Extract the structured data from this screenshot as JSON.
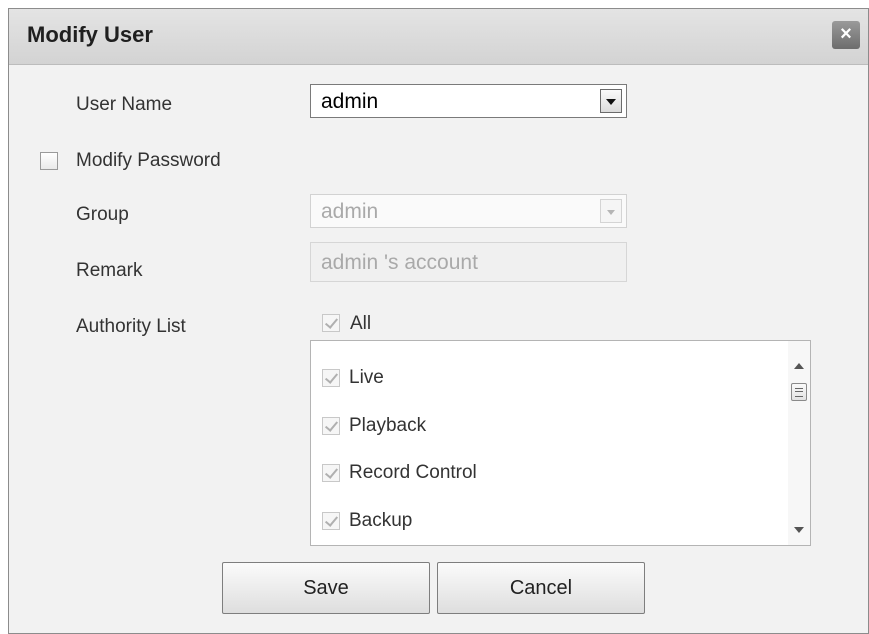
{
  "dialog": {
    "title": "Modify User",
    "close_glyph": "×"
  },
  "form": {
    "user_name_label": "User Name",
    "user_name_value": "admin",
    "modify_password_label": "Modify Password",
    "modify_password_checked": false,
    "group_label": "Group",
    "group_value": "admin",
    "remark_label": "Remark",
    "remark_value": "admin 's account",
    "authority_list_label": "Authority List",
    "authority_all_label": "All"
  },
  "authority_items": [
    {
      "label": "Live",
      "checked": true
    },
    {
      "label": "Playback",
      "checked": true
    },
    {
      "label": "Record Control",
      "checked": true
    },
    {
      "label": "Backup",
      "checked": true
    }
  ],
  "buttons": {
    "save_label": "Save",
    "cancel_label": "Cancel"
  },
  "icons": {
    "close": "close-icon",
    "dropdown": "chevron-down-icon",
    "checkbox": "checkbox-icon"
  }
}
